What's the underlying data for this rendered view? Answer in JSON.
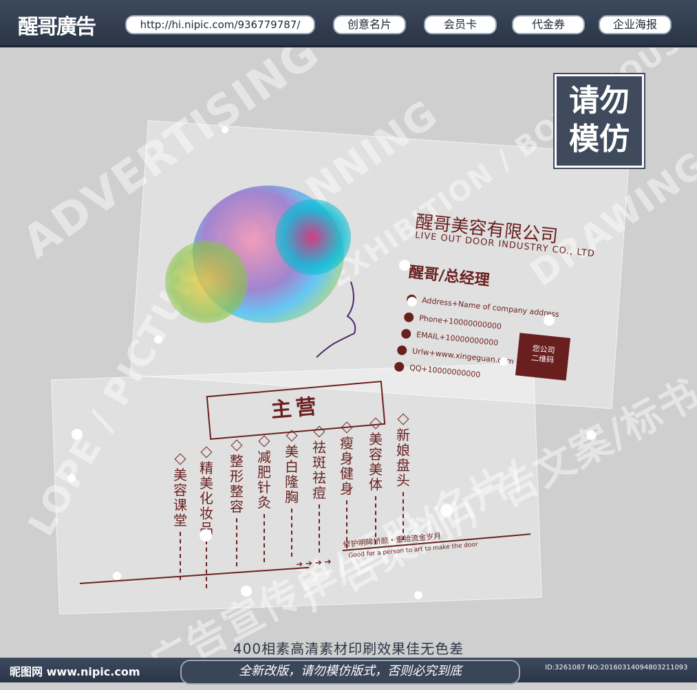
{
  "header": {
    "logo": "醒哥廣告",
    "url": "http://hi.nipic.com/936779787/",
    "nav": [
      "创意名片",
      "会员卡",
      "代金券",
      "企业海报"
    ]
  },
  "stamp": {
    "line1": "请勿",
    "line2": "模仿"
  },
  "card": {
    "company": "醒哥美容有限公司",
    "company_en": "LIVE OUT DOOR INDUSTRY CO., LTD",
    "person": "醒哥/总经理",
    "contacts": [
      "Address+Name of company address",
      "Phone+10000000000",
      "EMAIL+10000000000",
      "Urlw+www.xingeguan.com",
      "QQ+10000000000"
    ],
    "qr_line1": "您公司",
    "qr_line2": "二维码",
    "main_heading": "主营",
    "services": [
      "美容课堂",
      "精美化妆品",
      "整形整容",
      "减肥针灸",
      "美白隆胸",
      "祛斑祛痘",
      "瘦身健身",
      "美容美体",
      "新娘盘头"
    ],
    "slogan_cn": "修护明眸娇颜・重拾流金岁月",
    "slogan_en": "Good for a person to art to make the door"
  },
  "background_words": [
    "ADVERTISING",
    "PLANNING",
    "EXHIBITION / BOX / HOUSE",
    "DRAWING",
    "LOPE / PICTURES",
    "广告策划/广告文案/标书/大型展",
    "广告宣传单/画册/名片/"
  ],
  "caption": "400相素高清素材印刷效果佳无色差",
  "footer": {
    "site": "昵图网 www.nipic.com",
    "warning": "全新改版，请勿模仿版式，否则必究到底",
    "image_id": "ID:3261087 NO:20160314094803211093"
  }
}
